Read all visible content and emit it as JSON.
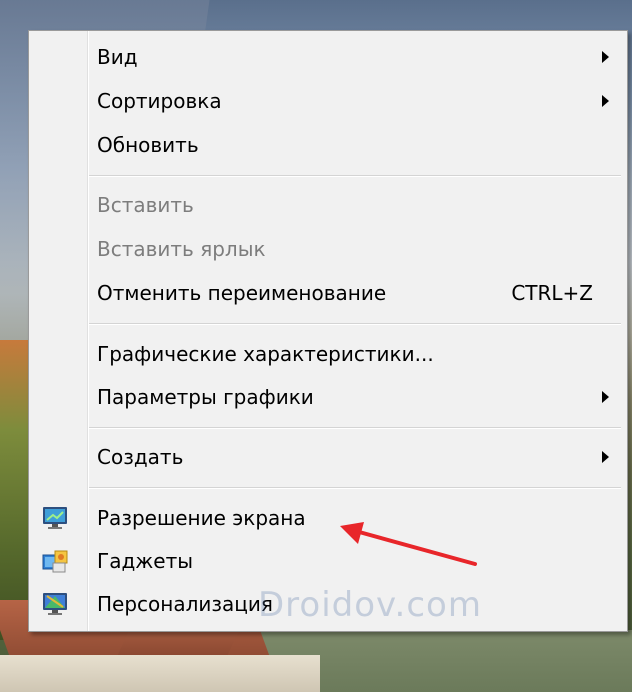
{
  "menu": {
    "items": [
      {
        "label": "Вид",
        "submenu": true
      },
      {
        "label": "Сортировка",
        "submenu": true
      },
      {
        "label": "Обновить"
      },
      {
        "label": "Вставить",
        "disabled": true
      },
      {
        "label": "Вставить ярлык",
        "disabled": true
      },
      {
        "label": "Отменить переименование",
        "shortcut": "CTRL+Z"
      },
      {
        "label": "Графические характеристики..."
      },
      {
        "label": "Параметры графики",
        "submenu": true
      },
      {
        "label": "Создать",
        "submenu": true
      },
      {
        "label": "Разрешение экрана",
        "icon": "monitor-icon"
      },
      {
        "label": "Гаджеты",
        "icon": "gadgets-icon"
      },
      {
        "label": "Персонализация",
        "icon": "personalization-icon"
      }
    ]
  },
  "annotation": {
    "color": "#e8262a"
  },
  "watermark": {
    "text": "Droidov.com"
  }
}
